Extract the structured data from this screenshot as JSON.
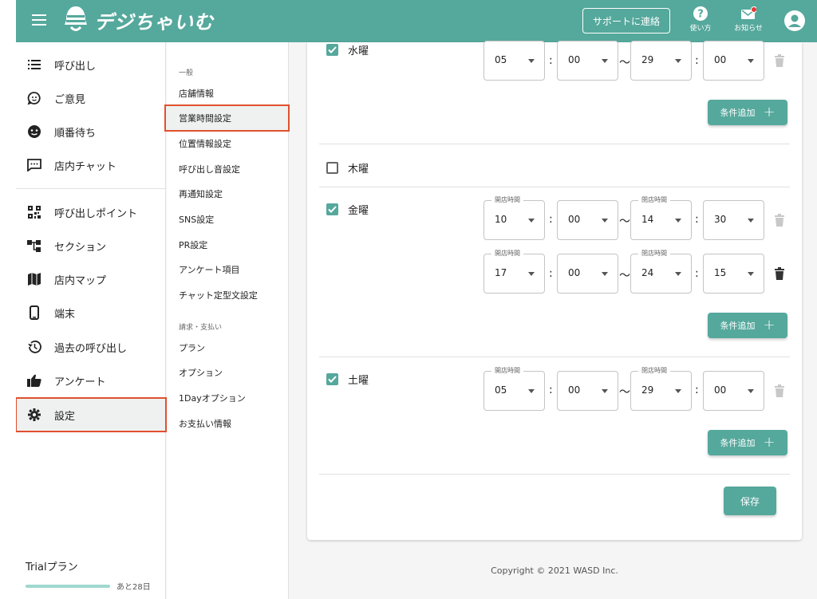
{
  "header": {
    "brand": "デジちゃいむ",
    "support_label": "サポートに連絡",
    "help_label": "使い方",
    "notice_label": "お知らせ",
    "bg_color": "#55a89c"
  },
  "sidebar": {
    "items": [
      {
        "label": "呼び出し",
        "icon": "list-icon"
      },
      {
        "label": "ご意見",
        "icon": "feedback-icon"
      },
      {
        "label": "順番待ち",
        "icon": "face-icon"
      },
      {
        "label": "店内チャット",
        "icon": "chat-icon"
      },
      {
        "label": "呼び出しポイント",
        "icon": "qr-icon"
      },
      {
        "label": "セクション",
        "icon": "section-icon"
      },
      {
        "label": "店内マップ",
        "icon": "map-icon"
      },
      {
        "label": "端末",
        "icon": "phone-icon"
      },
      {
        "label": "過去の呼び出し",
        "icon": "history-icon"
      },
      {
        "label": "アンケート",
        "icon": "thumbs-up-icon"
      },
      {
        "label": "設定",
        "icon": "gear-icon"
      }
    ],
    "trial_label": "Trialプラン",
    "trial_days": "あと28日"
  },
  "submenu": {
    "general_heading": "一般",
    "general": [
      "店舗情報",
      "営業時間設定",
      "位置情報設定",
      "呼び出し音設定",
      "再通知設定",
      "SNS設定",
      "PR設定",
      "アンケート項目",
      "チャット定型文設定"
    ],
    "billing_heading": "請求・支払い",
    "billing": [
      "プラン",
      "オプション",
      "1Dayオプション",
      "お支払い情報"
    ]
  },
  "labels": {
    "open": "開店時間",
    "close": "閉店時間",
    "add_condition": "条件追加",
    "save": "保存",
    "colon": ":",
    "tilde": "〜",
    "plus": "+"
  },
  "days": [
    {
      "name": "水曜",
      "checked": true,
      "slots": [
        {
          "oh": "05",
          "om": "00",
          "ch": "29",
          "cm": "00"
        }
      ]
    },
    {
      "name": "木曜",
      "checked": false,
      "slots": []
    },
    {
      "name": "金曜",
      "checked": true,
      "slots": [
        {
          "oh": "10",
          "om": "00",
          "ch": "14",
          "cm": "30"
        },
        {
          "oh": "17",
          "om": "00",
          "ch": "24",
          "cm": "15"
        }
      ]
    },
    {
      "name": "土曜",
      "checked": true,
      "slots": [
        {
          "oh": "05",
          "om": "00",
          "ch": "29",
          "cm": "00"
        }
      ]
    }
  ],
  "footer": {
    "copyright": "Copyright © 2021 WASD Inc."
  }
}
